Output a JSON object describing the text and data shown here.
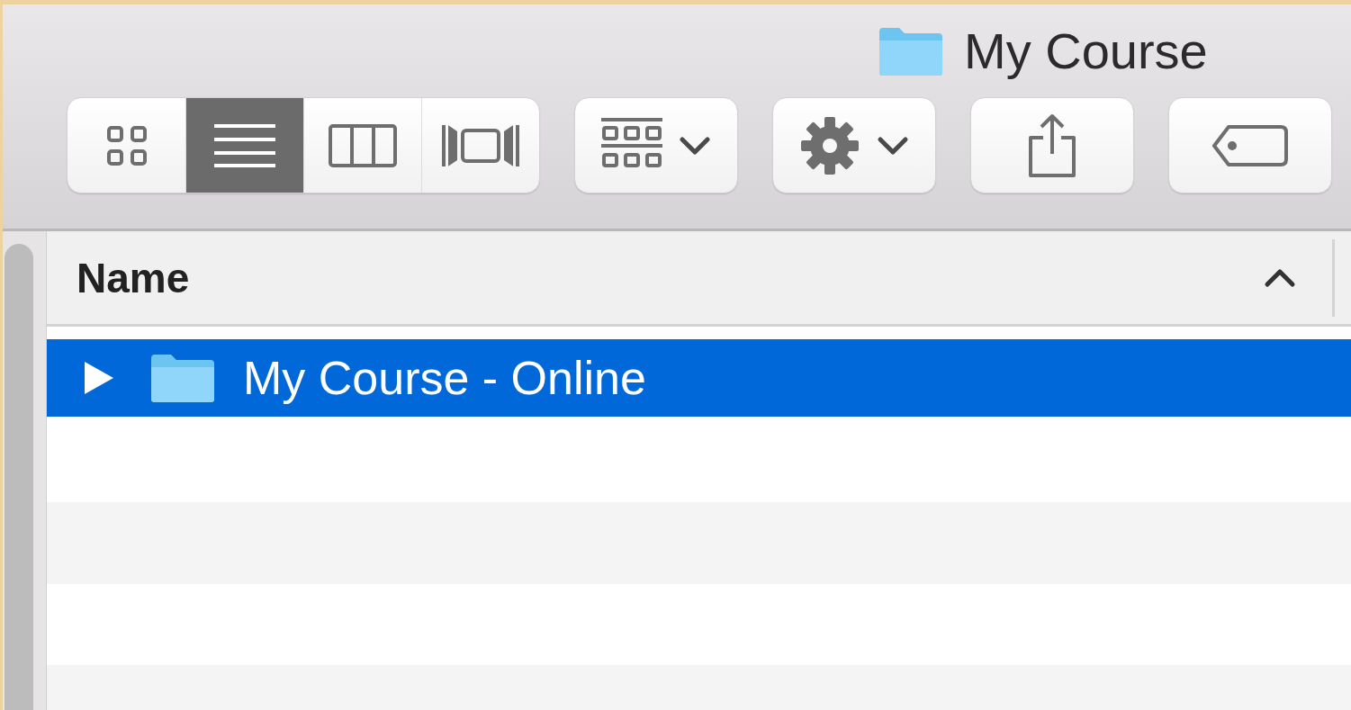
{
  "window": {
    "title": "My Course"
  },
  "toolbar": {
    "view_modes": [
      {
        "kind": "icons",
        "selected": false
      },
      {
        "kind": "list",
        "selected": true
      },
      {
        "kind": "columns",
        "selected": false
      },
      {
        "kind": "gallery",
        "selected": false
      }
    ]
  },
  "table": {
    "columns": [
      {
        "label": "Name",
        "sort_ascending": true
      }
    ],
    "rows": [
      {
        "name": "My Course - Online",
        "selected": true,
        "expanded": false
      }
    ]
  }
}
